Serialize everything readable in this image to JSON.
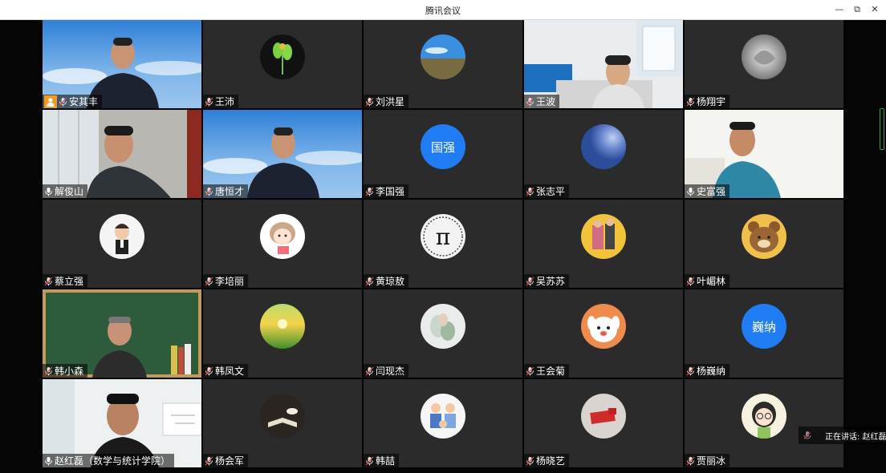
{
  "window": {
    "title": "腾讯会议",
    "minimize": "—",
    "restore": "⧉",
    "close": "✕"
  },
  "participants": [
    {
      "name": "安其丰",
      "kind": "video",
      "scene": "sky",
      "host": true
    },
    {
      "name": "王沛",
      "kind": "avatar",
      "avatar": "plant"
    },
    {
      "name": "刘洪星",
      "kind": "avatar",
      "avatar": "landscape"
    },
    {
      "name": "王波",
      "kind": "video",
      "scene": "room"
    },
    {
      "name": "杨翔宇",
      "kind": "avatar",
      "avatar": "silver"
    },
    {
      "name": "解俊山",
      "kind": "video",
      "scene": "office"
    },
    {
      "name": "唐恒才",
      "kind": "video",
      "scene": "sky"
    },
    {
      "name": "李国强",
      "kind": "avatar",
      "avatar": "text",
      "text": "国强"
    },
    {
      "name": "张志平",
      "kind": "avatar",
      "avatar": "blue-sphere"
    },
    {
      "name": "史富强",
      "kind": "video",
      "scene": "bright-room"
    },
    {
      "name": "蔡立强",
      "kind": "avatar",
      "avatar": "cartoon-man"
    },
    {
      "name": "李培丽",
      "kind": "avatar",
      "avatar": "cartoon-girl"
    },
    {
      "name": "黄琼敖",
      "kind": "avatar",
      "avatar": "pi"
    },
    {
      "name": "吴苏苏",
      "kind": "avatar",
      "avatar": "photo-yellow"
    },
    {
      "name": "叶嵋林",
      "kind": "avatar",
      "avatar": "bear"
    },
    {
      "name": "韩小森",
      "kind": "video",
      "scene": "blackboard"
    },
    {
      "name": "韩凤文",
      "kind": "avatar",
      "avatar": "sunrise"
    },
    {
      "name": "闫现杰",
      "kind": "avatar",
      "avatar": "photo-pale"
    },
    {
      "name": "王会菊",
      "kind": "avatar",
      "avatar": "dog"
    },
    {
      "name": "杨巍纳",
      "kind": "avatar",
      "avatar": "text",
      "text": "巍纳"
    },
    {
      "name": "赵红磊（数学与统计学院）",
      "kind": "video",
      "scene": "white-room",
      "active": true
    },
    {
      "name": "杨会军",
      "kind": "avatar",
      "avatar": "book"
    },
    {
      "name": "韩喆",
      "kind": "avatar",
      "avatar": "family"
    },
    {
      "name": "杨晓艺",
      "kind": "avatar",
      "avatar": "red-object"
    },
    {
      "name": "贾丽冰",
      "kind": "avatar",
      "avatar": "cartoon-glasses"
    }
  ],
  "speaking": {
    "text": "正在讲话: 赵红磊"
  },
  "colors": {
    "tile_bg": "#2b2b2b",
    "accent_blue": "#1f7cf2",
    "active_green": "#2fb94c",
    "host_orange": "#f39a1d"
  }
}
